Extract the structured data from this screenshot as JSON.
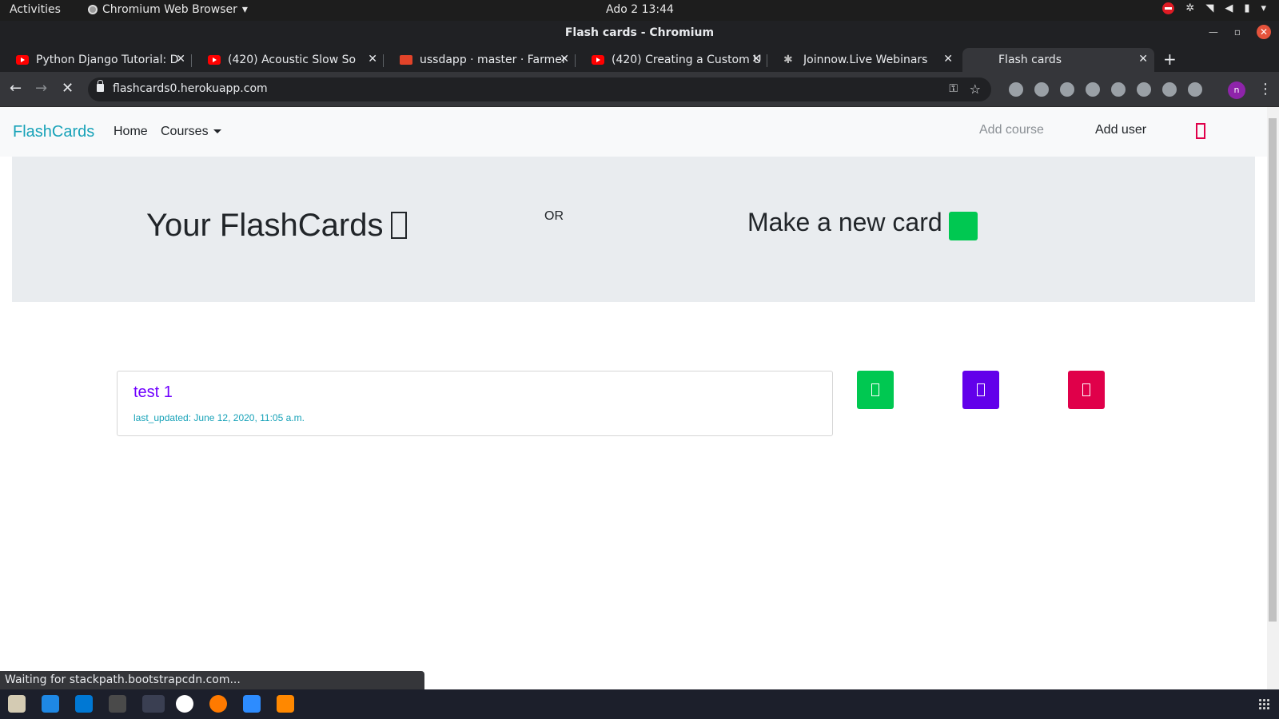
{
  "os": {
    "activities": "Activities",
    "app_name": "Chromium Web Browser",
    "clock": "Ado 2  13:44"
  },
  "window": {
    "title": "Flash cards - Chromium"
  },
  "tabs": [
    {
      "label": "Python Django Tutorial: D",
      "icon": "youtube-icon"
    },
    {
      "label": "(420) Acoustic Slow So",
      "icon": "youtube-icon"
    },
    {
      "label": "ussdapp · master · Farmer",
      "icon": "gitlab-icon"
    },
    {
      "label": "(420) Creating a Custom U",
      "icon": "youtube-icon"
    },
    {
      "label": "Joinnow.Live Webinars",
      "icon": "star-icon"
    },
    {
      "label": "Flash cards",
      "icon": "loading-icon"
    }
  ],
  "browser": {
    "url": "flashcards0.herokuapp.com",
    "profile_initial": "n",
    "status": "Waiting for stackpath.bootstrapcdn.com..."
  },
  "navbar": {
    "brand": "FlashCards",
    "home": "Home",
    "courses": "Courses",
    "add_course": "Add course",
    "add_user": "Add user"
  },
  "jumbotron": {
    "heading": "Your FlashCards",
    "or": "OR",
    "make_new": "Make a new card"
  },
  "cards": [
    {
      "title": "test 1",
      "meta": "last_updated: June 12, 2020, 11:05 a.m."
    }
  ],
  "colors": {
    "brand": "#17a2b8",
    "card_title": "#6f00ff",
    "btn_green": "#00c851",
    "btn_purple": "#6200ea",
    "btn_red": "#e0004a"
  }
}
